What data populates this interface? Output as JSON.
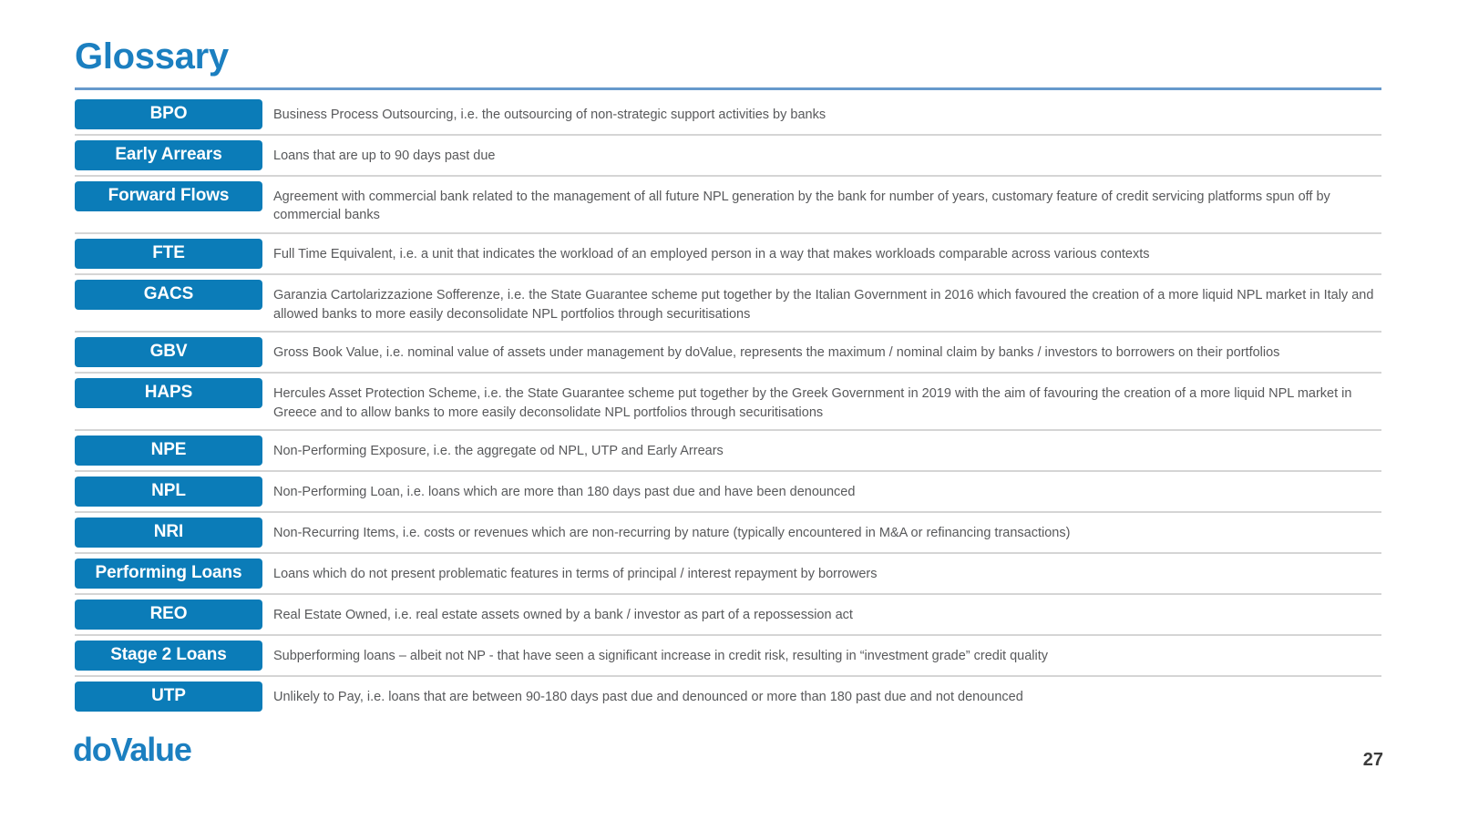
{
  "slide": {
    "title": "Glossary",
    "page_number": "27",
    "logo_text": "doValue",
    "accent_color": "#0b7cb8",
    "title_color": "#1b7fc0",
    "rule_color": "#6699cc",
    "row_divider_color": "#d5d5d5",
    "definition_color": "#58595b"
  },
  "glossary": {
    "entries": [
      {
        "term": "BPO",
        "definition": "Business Process Outsourcing, i.e. the outsourcing of non-strategic support activities by banks"
      },
      {
        "term": "Early Arrears",
        "definition": "Loans that are up to 90 days past due"
      },
      {
        "term": "Forward Flows",
        "definition": "Agreement with commercial bank related to the management of all future NPL generation by the bank for number of years, customary feature of credit servicing platforms spun off by commercial banks"
      },
      {
        "term": "FTE",
        "definition": "Full Time Equivalent, i.e. a unit that indicates the workload of an employed person in a way that makes workloads comparable across various contexts"
      },
      {
        "term": "GACS",
        "definition": "Garanzia Cartolarizzazione Sofferenze, i.e. the State Guarantee scheme put together by the Italian Government in 2016 which favoured the creation of a more liquid NPL market in Italy and allowed banks to more easily deconsolidate NPL portfolios through securitisations"
      },
      {
        "term": "GBV",
        "definition": "Gross Book Value, i.e. nominal value of assets under management by doValue, represents the maximum / nominal claim by banks / investors to borrowers on their portfolios"
      },
      {
        "term": "HAPS",
        "definition": "Hercules Asset Protection Scheme, i.e. the State Guarantee scheme put together by the Greek Government in 2019 with the aim of favouring the creation of a more liquid NPL market in Greece and to allow banks to more easily deconsolidate NPL portfolios through securitisations"
      },
      {
        "term": "NPE",
        "definition": "Non-Performing Exposure, i.e. the aggregate od NPL, UTP and Early Arrears"
      },
      {
        "term": "NPL",
        "definition": "Non-Performing Loan, i.e. loans which are more than 180 days past due and have been denounced"
      },
      {
        "term": "NRI",
        "definition": "Non-Recurring Items, i.e. costs or revenues which are non-recurring by nature (typically encountered in M&A or refinancing transactions)"
      },
      {
        "term": "Performing Loans",
        "definition": "Loans which do not present problematic features in terms of principal / interest repayment by borrowers"
      },
      {
        "term": "REO",
        "definition": "Real Estate Owned, i.e. real estate assets owned by a bank / investor as part of a repossession act"
      },
      {
        "term": "Stage 2 Loans",
        "definition": "Subperforming loans – albeit not NP - that have seen a significant increase in credit risk, resulting in “investment grade” credit quality"
      },
      {
        "term": "UTP",
        "definition": "Unlikely to Pay, i.e. loans that are between 90-180 days past due and denounced or more than 180 past due and not denounced"
      }
    ]
  }
}
